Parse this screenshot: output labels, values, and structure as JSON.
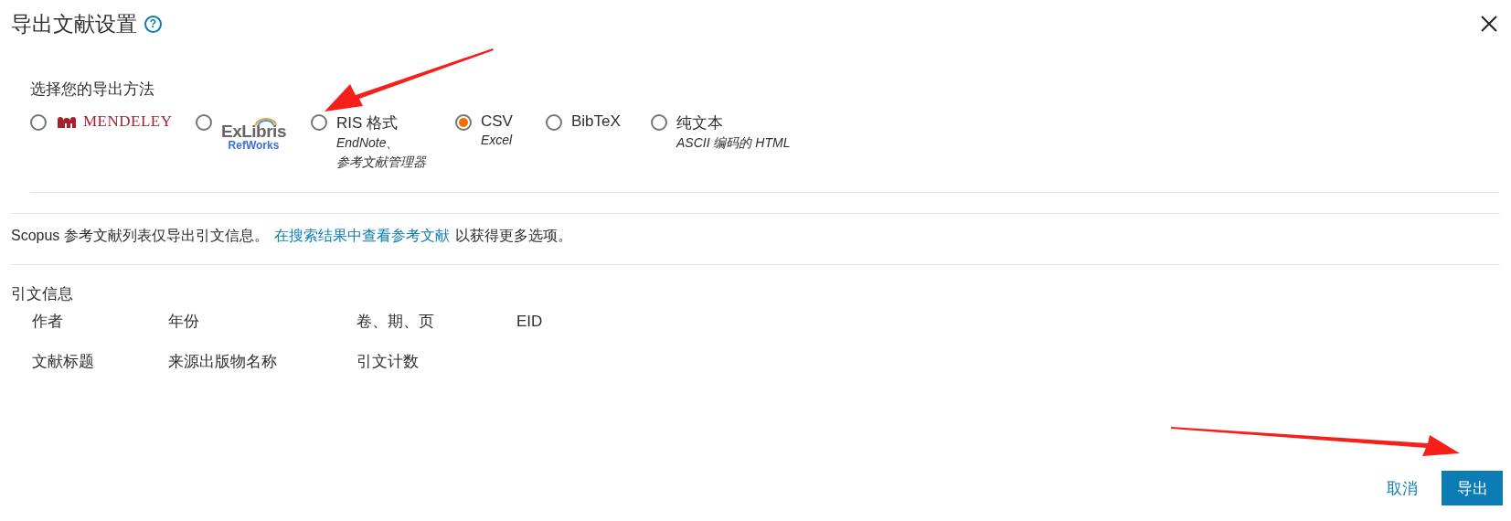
{
  "dialog": {
    "title": "导出文献设置",
    "help_icon": "?"
  },
  "method": {
    "label": "选择您的导出方法",
    "options": [
      {
        "kind": "mendeley",
        "label": "MENDELEY",
        "selected": false
      },
      {
        "kind": "refworks",
        "label": "ExLibris",
        "sublabel": "RefWorks",
        "selected": false
      },
      {
        "kind": "text",
        "label": "RIS 格式",
        "notes": [
          "EndNote、",
          "参考文献管理器"
        ],
        "selected": false
      },
      {
        "kind": "text",
        "label": "CSV",
        "notes": [
          "Excel"
        ],
        "selected": true
      },
      {
        "kind": "text",
        "label": "BibTeX",
        "selected": false
      },
      {
        "kind": "text",
        "label": "纯文本",
        "notes": [
          "ASCII 编码的 HTML"
        ],
        "selected": false
      }
    ]
  },
  "notice": {
    "text": "Scopus 参考文献列表仅导出引文信息。",
    "link": "在搜索结果中查看参考文献",
    "after": "以获得更多选项。"
  },
  "citation": {
    "heading": "引文信息",
    "fields": [
      "作者",
      "年份",
      "卷、期、页",
      "EID",
      "文献标题",
      "来源出版物名称",
      "引文计数"
    ]
  },
  "buttons": {
    "cancel": "取消",
    "export": "导出"
  }
}
